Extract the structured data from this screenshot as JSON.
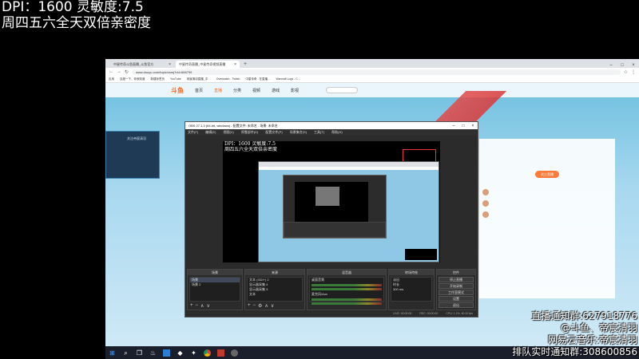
{
  "overlay": {
    "line1": "DPI：1600 灵敏度:7.5",
    "line2": "周四五六全天双倍亲密度",
    "info": [
      "直播通知群:627918776",
      "@斗鱼、帝宸清羽",
      "网易云音乐:帝宸清羽",
      "排队实时通知群:308600856"
    ]
  },
  "browser": {
    "tabs": [
      {
        "label": "中星传奇斗鱼直播_斗鱼官方",
        "active": false
      },
      {
        "label": "中星传奇直播_中星传奇视频直播",
        "active": true
      }
    ],
    "url": "www.douyu.com/topic/csmj?rid=666799",
    "bookmarks": [
      "应用",
      "百度一下，你就知道",
      "新建标签页",
      "YouTube",
      "帝宸清羽直播_中…",
      "Overwatch - Twitch",
      "中星传奇 - 在直播…",
      "Warcraft Logs - C…"
    ],
    "site": {
      "logo": "斗鱼",
      "nav": [
        "首页",
        "直播",
        "分类",
        "视频",
        "游戏",
        "影视"
      ],
      "active_nav": "直播",
      "follow_button": "关注直播",
      "panel_label": "关注帝宸清羽"
    }
  },
  "obs": {
    "title": "OBS 27.1.3 (64-bit, windows) - 配置文件: 未命名 - 场景: 未命名",
    "menu": [
      "文件(F)",
      "编辑(E)",
      "视图(V)",
      "停靠部件(D)",
      "配置文件(P)",
      "场景集合(S)",
      "工具(T)",
      "帮助(H)"
    ],
    "preview_text": [
      "DPI：1600 灵敏度:7.5",
      "周四五六全天双倍亲密度"
    ],
    "docks": {
      "scenes": {
        "title": "场景",
        "items": [
          "场景",
          "场景 2"
        ]
      },
      "sources": {
        "title": "来源",
        "items": [
          "文本 (GDI+) 2",
          "显示器采集 4",
          "显示器采集 3",
          "文本"
        ]
      },
      "mixer": {
        "title": "混音器",
        "channels": [
          "桌面音频",
          "麦克风/Aux"
        ]
      },
      "transitions": {
        "title": "转场特效",
        "type": "淡出",
        "duration_label": "时长",
        "duration": "300 ms"
      },
      "controls": {
        "title": "控件",
        "buttons": [
          "停止直播",
          "开始录制",
          "工作室模式",
          "设置",
          "退出"
        ]
      }
    },
    "status": [
      "LIVE: 00:00:00",
      "REC: 00:00:00",
      "CPU: 1.1%, 60.00 fps"
    ]
  },
  "taskbar": {
    "icons": [
      "windows-start",
      "search",
      "task-view",
      "steam",
      "app",
      "app",
      "app",
      "chrome",
      "app",
      "obs"
    ]
  }
}
